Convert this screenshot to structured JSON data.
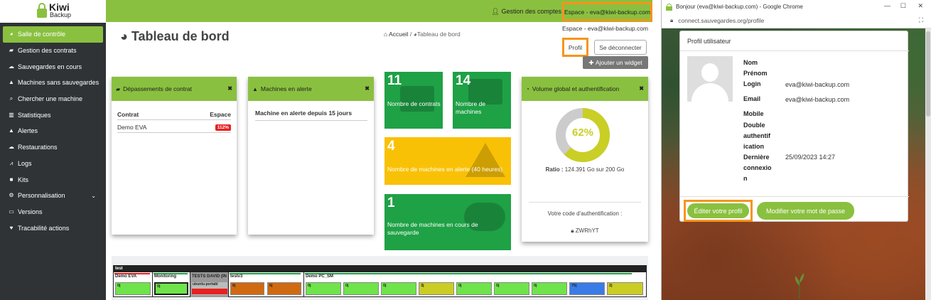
{
  "brand": {
    "line1": "Kiwi",
    "line2": "Backup",
    "accent": "#8ac03f"
  },
  "sidebar": {
    "items": [
      {
        "label": "Salle de contrôle",
        "icon": "dashboard-icon",
        "active": true
      },
      {
        "label": "Gestion des contrats",
        "icon": "folder-open-icon"
      },
      {
        "label": "Sauvegardes en cours",
        "icon": "cloud-upload-icon"
      },
      {
        "label": "Machines sans sauvegardes",
        "icon": "warning-icon"
      },
      {
        "label": "Chercher une machine",
        "icon": "search-icon"
      },
      {
        "label": "Statistiques",
        "icon": "bar-chart-icon"
      },
      {
        "label": "Alertes",
        "icon": "warning-icon"
      },
      {
        "label": "Restaurations",
        "icon": "cloud-download-icon"
      },
      {
        "label": "Logs",
        "icon": "line-chart-icon"
      },
      {
        "label": "Kits",
        "icon": "box-icon"
      },
      {
        "label": "Personnalisation",
        "icon": "gears-icon",
        "has_children": true
      },
      {
        "label": "Versions",
        "icon": "desktop-icon"
      },
      {
        "label": "Tracabilité actions",
        "icon": "heartbeat-icon"
      }
    ]
  },
  "topbar": {
    "accounts_label": "Gestion des comptes",
    "espace_label": "Espace - eva@kiwi-backup.com"
  },
  "dropdown": {
    "email": "Espace - eva@kiwi-backup.com",
    "profil_label": "Profil",
    "logout_label": "Se déconnecter"
  },
  "main": {
    "title": "Tableau de bord",
    "breadcrumb": {
      "home": "Accueil",
      "sep": "/",
      "current": "Tableau de bord"
    },
    "add_widget_label": "Ajouter un widget"
  },
  "widgets": {
    "contracts": {
      "title": "Dépassements de contrat",
      "col_contract": "Contrat",
      "col_space": "Espace",
      "rows": [
        {
          "contract": "Demo EVA",
          "space": "112%"
        }
      ]
    },
    "alerts": {
      "title": "Machines en alerte",
      "subtitle": "Machine en alerte depuis 15 jours"
    },
    "tiles": [
      {
        "value": "11",
        "label": "Nombre de contrats",
        "color": "#1fa146"
      },
      {
        "value": "14",
        "label": "Nombre de machines",
        "color": "#1fa146"
      },
      {
        "value": "4",
        "label": "Nombre de machines en alerte (40 heures)",
        "color": "#f9c106"
      },
      {
        "value": "1",
        "label": "Nombre de machines en cours de sauvegarde",
        "color": "#1fa146"
      }
    ],
    "volume": {
      "title": "Volume global et authentification",
      "percent": "62%",
      "percent_value": 62,
      "ratio_label": "Ratio :",
      "ratio_value": "124.391 Go sur 200 Go",
      "auth_label": "Votre code d'authentification :",
      "auth_code": "ZWRhYT",
      "donut_color": "#c9cf25",
      "donut_track": "#cccccc"
    }
  },
  "strip": {
    "header": "test",
    "groups": [
      {
        "title": "Demo EVA",
        "line_color": "#e82020",
        "cells": [
          {
            "label": "0j",
            "color": "#6ee44a"
          }
        ]
      },
      {
        "title": "Monitoring",
        "line_color": "#1fa146",
        "cells": [
          {
            "label": "0j",
            "color": "#6ee44a"
          }
        ]
      },
      {
        "title": "TESTS DAVID (IN",
        "line_color": "#888888",
        "header_bg": "#888888",
        "cells": [
          {
            "label": "ubuntu-portabl",
            "color": "#e82020"
          }
        ]
      },
      {
        "title": "testv3",
        "line_color": "#1fa146",
        "cells": [
          {
            "label": "6j",
            "color": "#d06a12"
          },
          {
            "label": "6j",
            "color": "#d06a12"
          }
        ]
      },
      {
        "title": "Demo PC_SM",
        "line_color": "#1fa146",
        "cells": [
          {
            "label": "0j",
            "color": "#6ee44a"
          },
          {
            "label": "0j",
            "color": "#6ee44a"
          },
          {
            "label": "0j",
            "color": "#6ee44a"
          },
          {
            "label": "3j",
            "color": "#cbcc24"
          },
          {
            "label": "0j",
            "color": "#6ee44a"
          },
          {
            "label": "0j",
            "color": "#6ee44a"
          },
          {
            "label": "0j",
            "color": "#6ee44a"
          },
          {
            "label": "75j",
            "color": "#3a7be8"
          },
          {
            "label": "2j",
            "color": "#cbcc24"
          }
        ]
      }
    ]
  },
  "chrome": {
    "title": "Bonjour (eva@kiwi-backup.com) - Google Chrome",
    "url": "connect.sauvegardes.org/profile",
    "modal": {
      "title": "Profil utilisateur",
      "labels": [
        "Nom",
        "Prénom",
        "Login",
        "Email",
        "Mobile",
        "Double authentification",
        "Dernière connexion"
      ],
      "label_lines": {
        "nom": "Nom",
        "prenom": "Prénom",
        "login": "Login",
        "email": "Email",
        "mobile": "Mobile",
        "double1": "Double",
        "double2": "authentif",
        "double3": "ication",
        "derniere1": "Dernière",
        "derniere2": "connexio",
        "derniere3": "n"
      },
      "values": {
        "login": "eva@kiwi-backup.com",
        "email": "eva@kiwi-backup.com",
        "derniere_connexion": "25/09/2023 14:27"
      },
      "edit_label": "Éditer votre profil",
      "password_label": "Modifier votre mot de passe"
    }
  }
}
